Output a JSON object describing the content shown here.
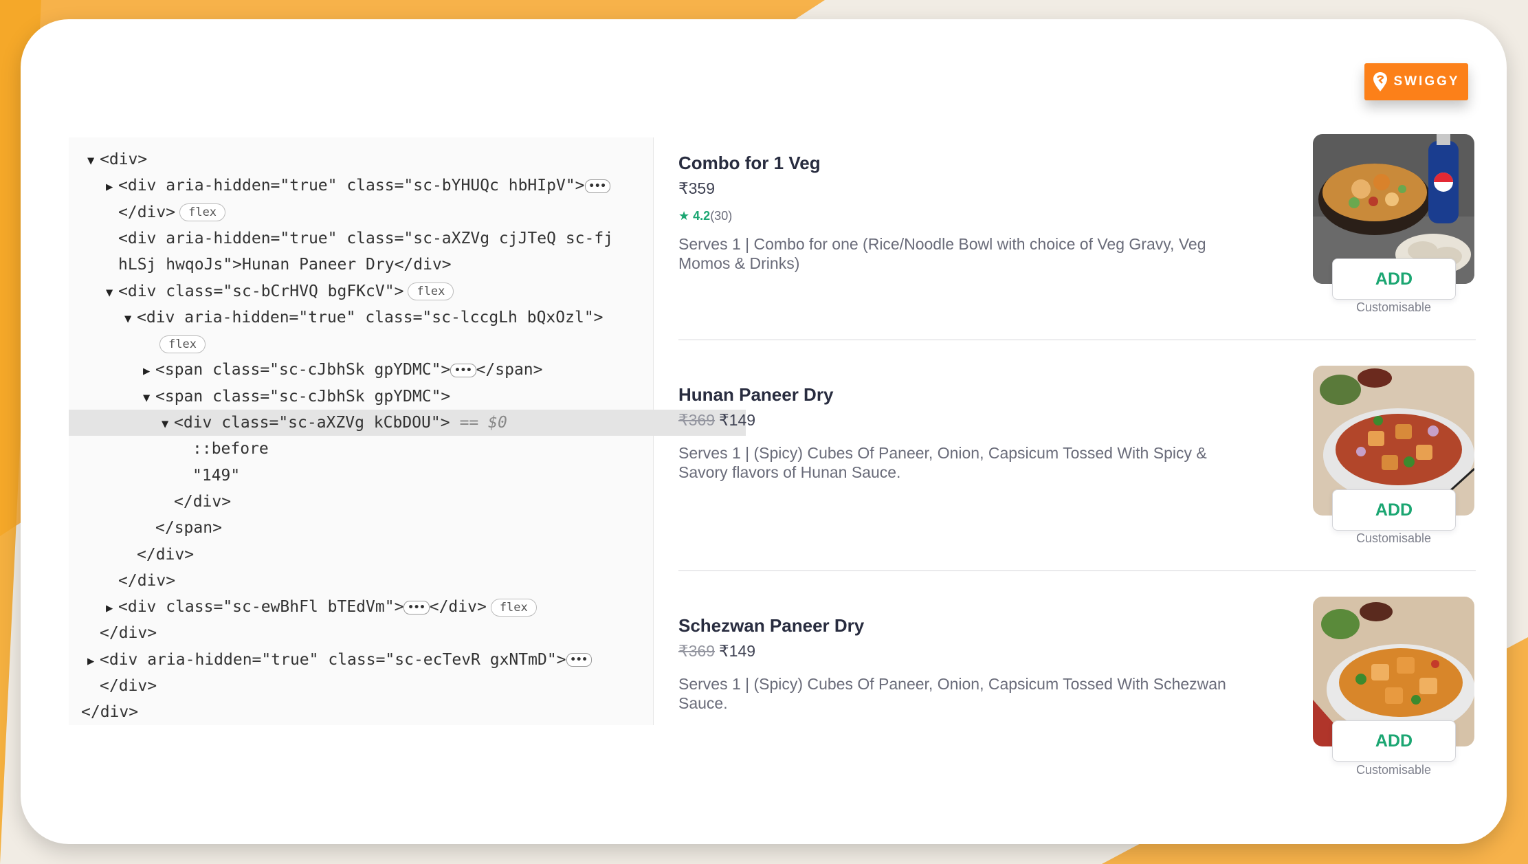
{
  "brand": {
    "logo_text": "SWIGGY",
    "accent": "#fc8019",
    "add_color": "#1ba672"
  },
  "devtools": {
    "lines": [
      {
        "indent": 0,
        "tri": "▼",
        "text": "<div>",
        "badge": "",
        "dots": false
      },
      {
        "indent": 1,
        "tri": "▶",
        "text": "<div aria-hidden=\"true\" class=\"sc-bYHUQc hbHIpV\">",
        "badge": "",
        "dots": true
      },
      {
        "indent": 1,
        "tri": "",
        "text": "</div>",
        "badge": "flex",
        "dots": false
      },
      {
        "indent": 1,
        "tri": "",
        "text": "<div aria-hidden=\"true\" class=\"sc-aXZVg cjJTeQ sc-fj",
        "badge": "",
        "dots": false
      },
      {
        "indent": 1,
        "tri": "",
        "text": "hLSj hwqoJs\">Hunan Paneer Dry</div>",
        "badge": "",
        "dots": false
      },
      {
        "indent": 1,
        "tri": "▼",
        "text": "<div class=\"sc-bCrHVQ bgFKcV\">",
        "badge": "flex",
        "dots": false
      },
      {
        "indent": 2,
        "tri": "▼",
        "text": "<div aria-hidden=\"true\" class=\"sc-lccgLh bQxOzl\">",
        "badge": "",
        "dots": false
      },
      {
        "indent": 3,
        "tri": "",
        "text": "",
        "badge": "flex",
        "dots": false
      },
      {
        "indent": 3,
        "tri": "▶",
        "text": "<span class=\"sc-cJbhSk gpYDMC\">",
        "badge": "",
        "dots": true,
        "after": "</span>"
      },
      {
        "indent": 3,
        "tri": "▼",
        "text": "<span class=\"sc-cJbhSk gpYDMC\">",
        "badge": "",
        "dots": false
      },
      {
        "indent": 4,
        "tri": "▼",
        "text": "<div class=\"sc-aXZVg kCbDOU\">",
        "badge": "",
        "dots": false,
        "selected": true,
        "eq": "== $0"
      },
      {
        "indent": 5,
        "tri": "",
        "text": "::before",
        "badge": "",
        "dots": false
      },
      {
        "indent": 5,
        "tri": "",
        "text": "\"149\"",
        "badge": "",
        "dots": false
      },
      {
        "indent": 4,
        "tri": "",
        "text": "</div>",
        "badge": "",
        "dots": false
      },
      {
        "indent": 3,
        "tri": "",
        "text": "</span>",
        "badge": "",
        "dots": false
      },
      {
        "indent": 2,
        "tri": "",
        "text": "</div>",
        "badge": "",
        "dots": false
      },
      {
        "indent": 1,
        "tri": "",
        "text": "</div>",
        "badge": "",
        "dots": false
      },
      {
        "indent": 1,
        "tri": "▶",
        "text": "<div class=\"sc-ewBhFl bTEdVm\">",
        "badge": "flex",
        "dots": true,
        "after": "</div>"
      },
      {
        "indent": 0,
        "tri": "",
        "text": "</div>",
        "badge": "",
        "dots": false
      },
      {
        "indent": 0,
        "tri": "▶",
        "text": "<div aria-hidden=\"true\" class=\"sc-ecTevR gxNTmD\">",
        "badge": "",
        "dots": true
      },
      {
        "indent": 0,
        "tri": "",
        "text": "</div>",
        "badge": "",
        "dots": false
      },
      {
        "indent": -1,
        "tri": "",
        "text": "</div>",
        "badge": "",
        "dots": false
      }
    ]
  },
  "menu": {
    "items": [
      {
        "name": "Combo for 1 Veg",
        "price_old": "",
        "price": "₹359",
        "rating_star": "★",
        "rating": "4.2",
        "rating_count": "(30)",
        "description": "Serves 1 | Combo for one (Rice/Noodle Bowl with choice of Veg Gravy, Veg Momos & Drinks)",
        "add_label": "ADD",
        "customisable": "Customisable",
        "image_icon": "combo-bowl-pepsi-image"
      },
      {
        "name": "Hunan Paneer Dry",
        "price_old": "₹369",
        "price": "₹149",
        "description": "Serves 1 | (Spicy) Cubes Of Paneer, Onion, Capsicum Tossed With Spicy & Savory flavors of Hunan Sauce.",
        "add_label": "ADD",
        "customisable": "Customisable",
        "image_icon": "paneer-dish-image"
      },
      {
        "name": "Schezwan Paneer Dry",
        "price_old": "₹369",
        "price": "₹149",
        "description": "Serves 1 | (Spicy) Cubes Of Paneer, Onion, Capsicum Tossed With Schezwan Sauce.",
        "add_label": "ADD",
        "customisable": "Customisable",
        "image_icon": "paneer-dish-image"
      }
    ]
  }
}
